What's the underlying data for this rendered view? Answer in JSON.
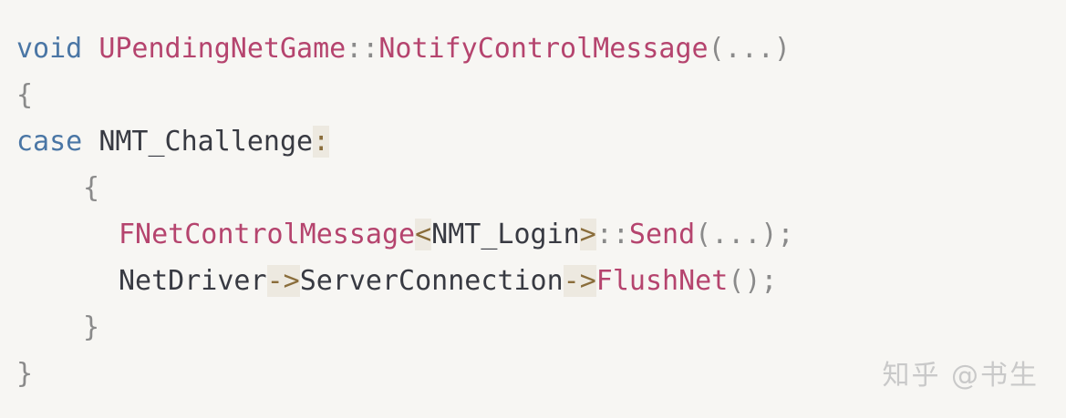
{
  "code": {
    "line1": {
      "keyword": "void",
      "class_name": "UPendingNetGame",
      "scope": "::",
      "method": "NotifyControlMessage",
      "args": "(...)"
    },
    "line2": {
      "brace": "{"
    },
    "line3": {
      "keyword": "case",
      "label": "NMT_Challenge",
      "colon": ":"
    },
    "line4": {
      "brace": "{"
    },
    "line5": {
      "class_name": "FNetControlMessage",
      "lt": "<",
      "template_arg": "NMT_Login",
      "gt": ">",
      "scope": "::",
      "method": "Send",
      "args": "(...);"
    },
    "line6": {
      "object": "NetDriver",
      "arrow1": "->",
      "member": "ServerConnection",
      "arrow2": "->",
      "method": "FlushNet",
      "args": "();"
    },
    "line7": {
      "brace": "}"
    },
    "line8": {
      "brace": "}"
    }
  },
  "watermark": {
    "text": "知乎 @书生"
  }
}
